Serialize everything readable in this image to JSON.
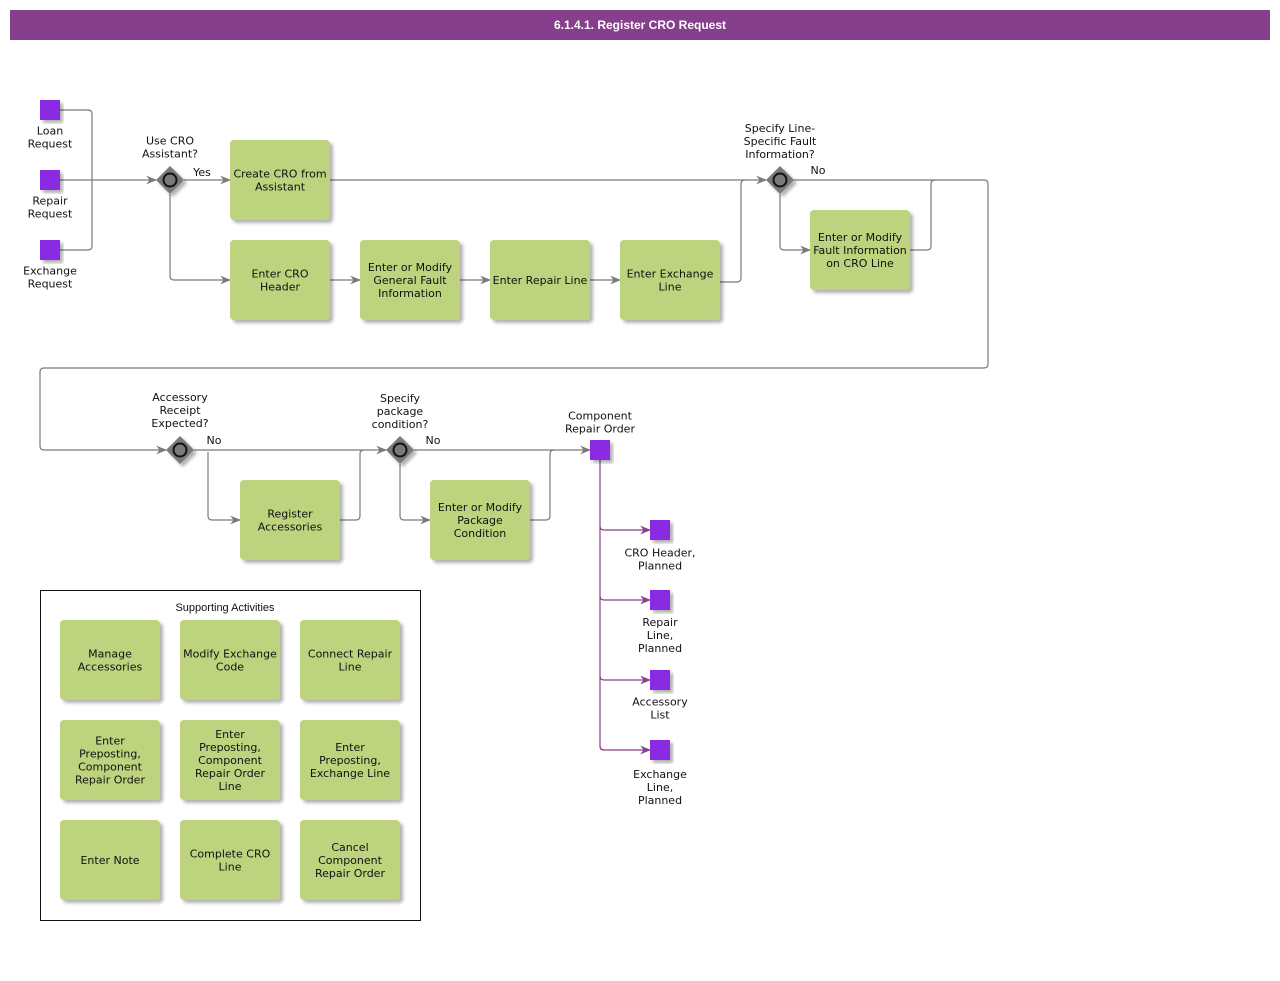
{
  "title": "6.1.4.1. Register CRO Request",
  "colors": {
    "header": "#863f8a",
    "activity_fill": "#bed37e",
    "event_fill": "#8a2be2",
    "gateway_fill": "#7a7a7a",
    "flow_line": "#7a7a7a",
    "output_line": "#8a3e8e"
  },
  "start_events": [
    {
      "id": "loan",
      "label": [
        "Loan",
        "Request"
      ]
    },
    {
      "id": "repair",
      "label": [
        "Repair",
        "Request"
      ]
    },
    {
      "id": "exchange",
      "label": [
        "Exchange",
        "Request"
      ]
    }
  ],
  "gateways": [
    {
      "id": "g1",
      "label": [
        "Use CRO",
        "Assistant?"
      ],
      "branch_label": "Yes"
    },
    {
      "id": "g2",
      "label": [
        "Specify Line-",
        "Specific Fault",
        "Information?"
      ],
      "branch_label": "No"
    },
    {
      "id": "g3",
      "label": [
        "Accessory",
        "Receipt",
        "Expected?"
      ],
      "branch_label": "No"
    },
    {
      "id": "g4",
      "label": [
        "Specify",
        "package",
        "condition?"
      ],
      "branch_label": "No"
    }
  ],
  "activities": [
    {
      "id": "a1",
      "label": [
        "Create CRO from",
        "Assistant"
      ]
    },
    {
      "id": "a2",
      "label": [
        "Enter CRO",
        "Header"
      ]
    },
    {
      "id": "a3",
      "label": [
        "Enter or Modify",
        "General Fault",
        "Information"
      ]
    },
    {
      "id": "a4",
      "label": [
        "Enter Repair Line"
      ]
    },
    {
      "id": "a5",
      "label": [
        "Enter Exchange",
        "Line"
      ]
    },
    {
      "id": "a6",
      "label": [
        "Enter or Modify",
        "Fault Information",
        "on CRO Line"
      ]
    },
    {
      "id": "a7",
      "label": [
        "Register",
        "Accessories"
      ]
    },
    {
      "id": "a8",
      "label": [
        "Enter or Modify",
        "Package",
        "Condition"
      ]
    }
  ],
  "end_event": {
    "id": "cro",
    "label": [
      "Component",
      "Repair Order"
    ]
  },
  "outputs": [
    {
      "id": "o1",
      "label": [
        "CRO Header,",
        "Planned"
      ]
    },
    {
      "id": "o2",
      "label": [
        "Repair",
        "Line,",
        "Planned"
      ]
    },
    {
      "id": "o3",
      "label": [
        "Accessory",
        "List"
      ]
    },
    {
      "id": "o4",
      "label": [
        "Exchange",
        "Line,",
        "Planned"
      ]
    }
  ],
  "supporting": {
    "title": "Supporting Activities",
    "items": [
      {
        "label": [
          "Manage",
          "Accessories"
        ]
      },
      {
        "label": [
          "Modify Exchange",
          "Code"
        ]
      },
      {
        "label": [
          "Connect Repair",
          "Line"
        ]
      },
      {
        "label": [
          "Enter",
          "Preposting,",
          "Component",
          "Repair Order"
        ]
      },
      {
        "label": [
          "Enter",
          "Preposting,",
          "Component",
          "Repair Order",
          "Line"
        ]
      },
      {
        "label": [
          "Enter",
          "Preposting,",
          "Exchange Line"
        ]
      },
      {
        "label": [
          "Enter Note"
        ]
      },
      {
        "label": [
          "Complete CRO",
          "Line"
        ]
      },
      {
        "label": [
          "Cancel",
          "Component",
          "Repair Order"
        ]
      }
    ]
  }
}
